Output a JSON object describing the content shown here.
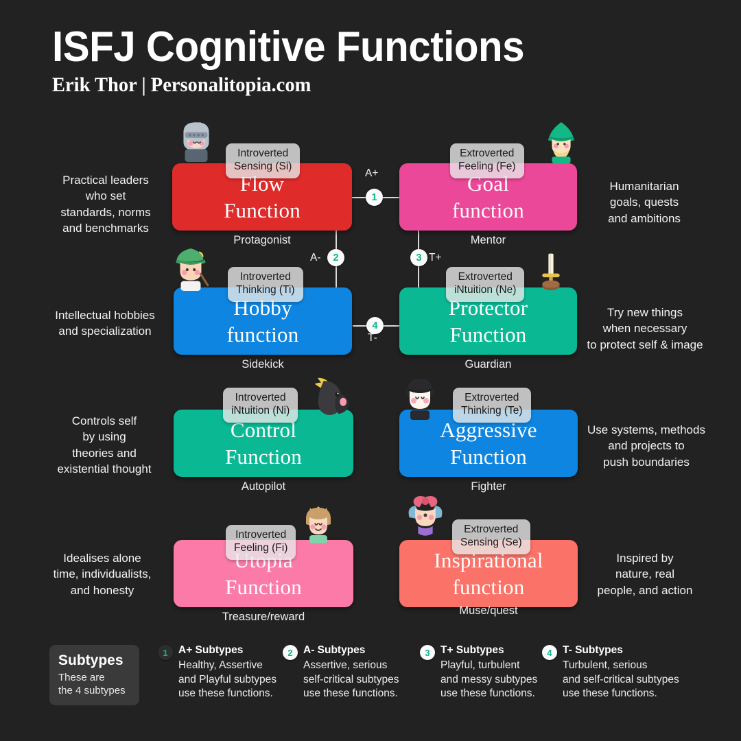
{
  "header": {
    "title": "ISFJ Cognitive Functions",
    "subtitle": "Erik Thor | Personalitopia.com"
  },
  "colors": {
    "background": "#222222",
    "red": "#e02b2b",
    "pink": "#ec4899",
    "blue": "#0e85e0",
    "green": "#0bb894",
    "light_pink": "#fb7aa8",
    "coral": "#fa7268",
    "badge_accent": "#09b68c",
    "connector": "#d9d9d9"
  },
  "functions": [
    {
      "id": "flow",
      "function_label": "Introverted\nSensing (Si)",
      "function_line1": "Introverted",
      "function_line2": "Sensing (Si)",
      "title_line1": "Flow",
      "title_line2": "Function",
      "role": "Protagonist",
      "description": "Practical leaders\nwho set\nstandards, norms\nand benchmarks",
      "description_lines": [
        "Practical leaders",
        "who set",
        "standards, norms",
        "and benchmarks"
      ],
      "color": "#e02b2b",
      "side": "left",
      "avatar": "knight-avatar"
    },
    {
      "id": "goal",
      "function_label": "Extroverted\nFeeling (Fe)",
      "function_line1": "Extroverted",
      "function_line2": "Feeling (Fe)",
      "title_line1": "Goal",
      "title_line2": "function",
      "role": "Mentor",
      "description": "Humanitarian\ngoals, quests\nand ambitions",
      "description_lines": [
        "Humanitarian",
        "goals, quests",
        "and ambitions"
      ],
      "color": "#ec4899",
      "side": "right",
      "avatar": "wizard-avatar"
    },
    {
      "id": "hobby",
      "function_label": "Introverted\nThinking (Ti)",
      "function_line1": "Introverted",
      "function_line2": "Thinking (Ti)",
      "title_line1": "Hobby",
      "title_line2": "function",
      "role": "Sidekick",
      "description": "Intellectual hobbies\nand specialization",
      "description_lines": [
        "Intellectual hobbies",
        "and specialization"
      ],
      "color": "#0e85e0",
      "side": "left",
      "avatar": "archer-avatar"
    },
    {
      "id": "protector",
      "function_label": "Extroverted\niNtuition (Ne)",
      "function_line1": "Extroverted",
      "function_line2": "iNtuition (Ne)",
      "title_line1": "Protector",
      "title_line2": "Function",
      "role": "Guardian",
      "description": "Try new things\nwhen necessary\nto protect self & image",
      "description_lines": [
        "Try new things",
        "when necessary",
        "to protect self & image"
      ],
      "color": "#0bb894",
      "side": "right",
      "avatar": "sword-avatar"
    },
    {
      "id": "control",
      "function_label": "Introverted\niNtuition (Ni)",
      "function_line1": "Introverted",
      "function_line2": "iNtuition (Ni)",
      "title_line1": "Control",
      "title_line2": "Function",
      "role": "Autopilot",
      "description": "Controls self\nby using\ntheories and\nexistential thought",
      "description_lines": [
        "Controls self",
        "by using",
        "theories and",
        "existential thought"
      ],
      "color": "#0bb894",
      "side": "left",
      "avatar": "dark-horse-avatar"
    },
    {
      "id": "aggressive",
      "function_label": "Extroverted\nThinking (Te)",
      "function_line1": "Extroverted",
      "function_line2": "Thinking (Te)",
      "title_line1": "Aggressive",
      "title_line2": "Function",
      "role": "Fighter",
      "description": "Use systems, methods\nand projects to\npush boundaries",
      "description_lines": [
        "Use systems, methods",
        "and projects to",
        "push boundaries"
      ],
      "color": "#0e85e0",
      "side": "right",
      "avatar": "vampire-avatar"
    },
    {
      "id": "utopia",
      "function_label": "Introverted\nFeeling (Fi)",
      "function_line1": "Introverted",
      "function_line2": "Feeling (Fi)",
      "title_line1": "Utopia",
      "title_line2": "Function",
      "role": "Treasure/reward",
      "description": "Idealises alone\ntime, individualists,\nand honesty",
      "description_lines": [
        "Idealises alone",
        "time, individualists,",
        "and honesty"
      ],
      "color": "#fb7aa8",
      "side": "left",
      "avatar": "princess-avatar"
    },
    {
      "id": "inspirational",
      "function_label": "Extroverted\nSensing (Se)",
      "function_line1": "Extroverted",
      "function_line2": "Sensing (Se)",
      "title_line1": "Inspirational",
      "title_line2": "function",
      "role": "Muse/quest",
      "description": "Inspired by\nnature, real\npeople, and action",
      "description_lines": [
        "Inspired by",
        "nature, real",
        "people, and action"
      ],
      "color": "#fa7268",
      "side": "right",
      "avatar": "fairy-avatar"
    }
  ],
  "connectors": [
    {
      "id": "c1",
      "number": "1",
      "tag": "A+"
    },
    {
      "id": "c2",
      "number": "2",
      "tag": "A-"
    },
    {
      "id": "c3",
      "number": "3",
      "tag": "T+"
    },
    {
      "id": "c4",
      "number": "4",
      "tag": "T-"
    }
  ],
  "legend": {
    "box_title": "Subtypes",
    "box_subtitle": "These are\nthe 4 subtypes",
    "box_sub_line1": "These are",
    "box_sub_line2": "the 4 subtypes",
    "items": [
      {
        "number": "1",
        "title": "A+ Subtypes",
        "body": "Healthy, Assertive\nand Playful subtypes\nuse these functions.",
        "body_lines": [
          "Healthy, Assertive",
          "and Playful subtypes",
          "use these functions."
        ],
        "badge_style": "dark"
      },
      {
        "number": "2",
        "title": "A- Subtypes",
        "body": "Assertive, serious\nself-critical subtypes\nuse these functions.",
        "body_lines": [
          "Assertive, serious",
          "self-critical subtypes",
          "use these functions."
        ],
        "badge_style": "light"
      },
      {
        "number": "3",
        "title": "T+ Subtypes",
        "body": "Playful, turbulent\nand messy subtypes\nuse these functions.",
        "body_lines": [
          "Playful, turbulent",
          "and messy subtypes",
          "use these functions."
        ],
        "badge_style": "light"
      },
      {
        "number": "4",
        "title": "T- Subtypes",
        "body": "Turbulent, serious\nand self-critical subtypes\nuse these functions.",
        "body_lines": [
          "Turbulent, serious",
          "and self-critical subtypes",
          "use these functions."
        ],
        "badge_style": "light"
      }
    ]
  }
}
